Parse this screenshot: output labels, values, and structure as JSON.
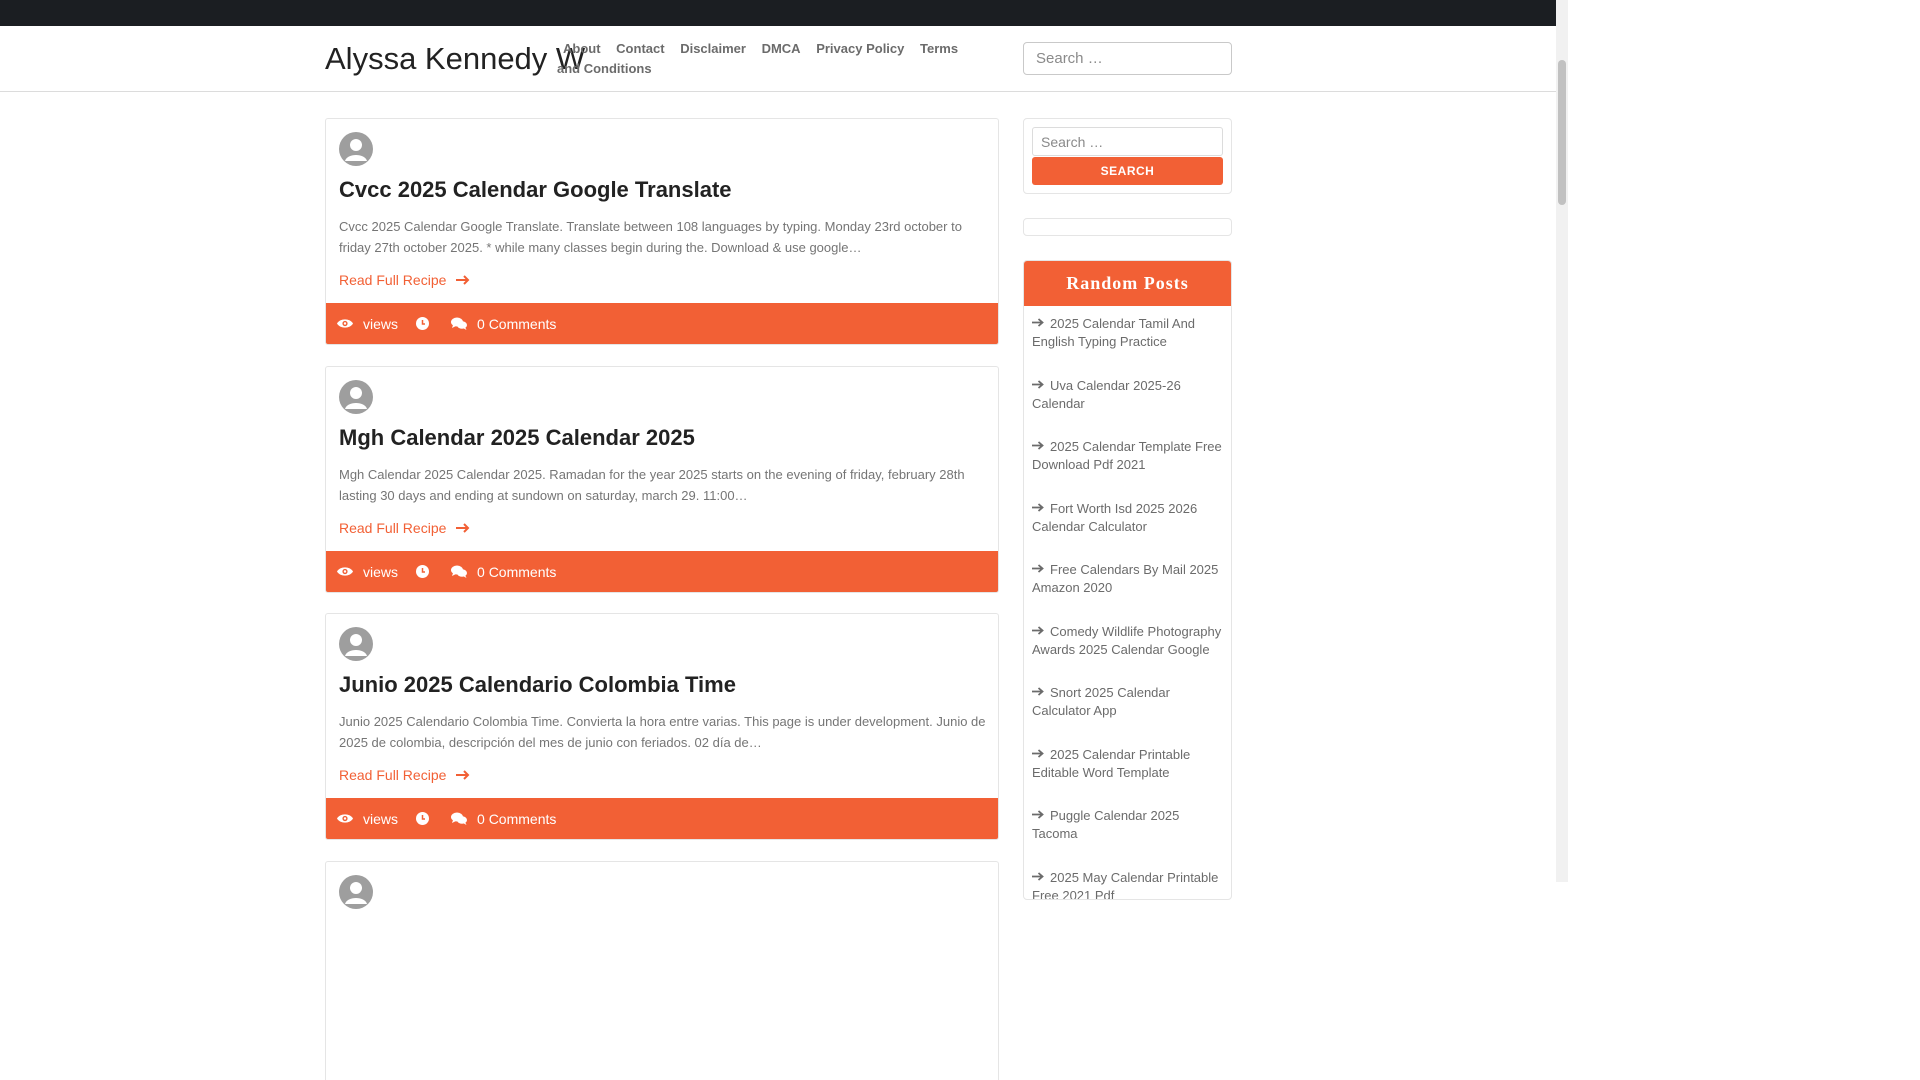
{
  "header": {
    "site_title": "Alyssa Kennedy W",
    "nav": [
      "About",
      "Contact",
      "Disclaimer",
      "DMCA",
      "Privacy Policy",
      "Terms and Conditions"
    ],
    "search_placeholder": "Search …"
  },
  "posts": [
    {
      "title": "Cvcc 2025 Calendar Google Translate",
      "excerpt": "Cvcc 2025 Calendar Google Translate. Translate between 108 languages by typing. Monday 23rd october to friday 27th october 2025. * while many classes begin during the. Download & use google…",
      "read_more": "Read Full Recipe",
      "views": "views",
      "comments": "0 Comments"
    },
    {
      "title": "Mgh Calendar 2025 Calendar 2025",
      "excerpt": "Mgh Calendar 2025 Calendar 2025. Ramadan for the year 2025 starts on the evening of friday, february 28th lasting 30 days and ending at sundown on saturday, march 29. 11:00…",
      "read_more": "Read Full Recipe",
      "views": "views",
      "comments": "0 Comments"
    },
    {
      "title": "Junio 2025 Calendario Colombia Time",
      "excerpt": "Junio 2025 Calendario Colombia Time. Convierta la hora entre varias. This page is under development. Junio de 2025 de colombia, descripción del mes de junio con feriados. 02 día de…",
      "read_more": "Read Full Recipe",
      "views": "views",
      "comments": "0 Comments"
    }
  ],
  "sidebar": {
    "search_placeholder": "Search …",
    "search_button": "SEARCH",
    "random_title": "Random Posts",
    "random_posts": [
      "2025 Calendar Tamil And English Typing Practice",
      "Uva Calendar 2025-26 Calendar",
      "2025 Calendar Template Free Download Pdf 2021",
      "Fort Worth Isd 2025 2026 Calendar Calculator",
      "Free Calendars By Mail 2025 Amazon 2020",
      "Comedy Wildlife Photography Awards 2025 Calendar Google",
      "Snort 2025 Calendar Calculator App",
      "2025 Calendar Printable Editable Word Template",
      "Puggle Calendar 2025 Tacoma",
      "2025 May Calendar Printable Free 2021 Pdf"
    ]
  },
  "colors": {
    "accent": "#f26035",
    "topbar": "#1b1e22"
  }
}
